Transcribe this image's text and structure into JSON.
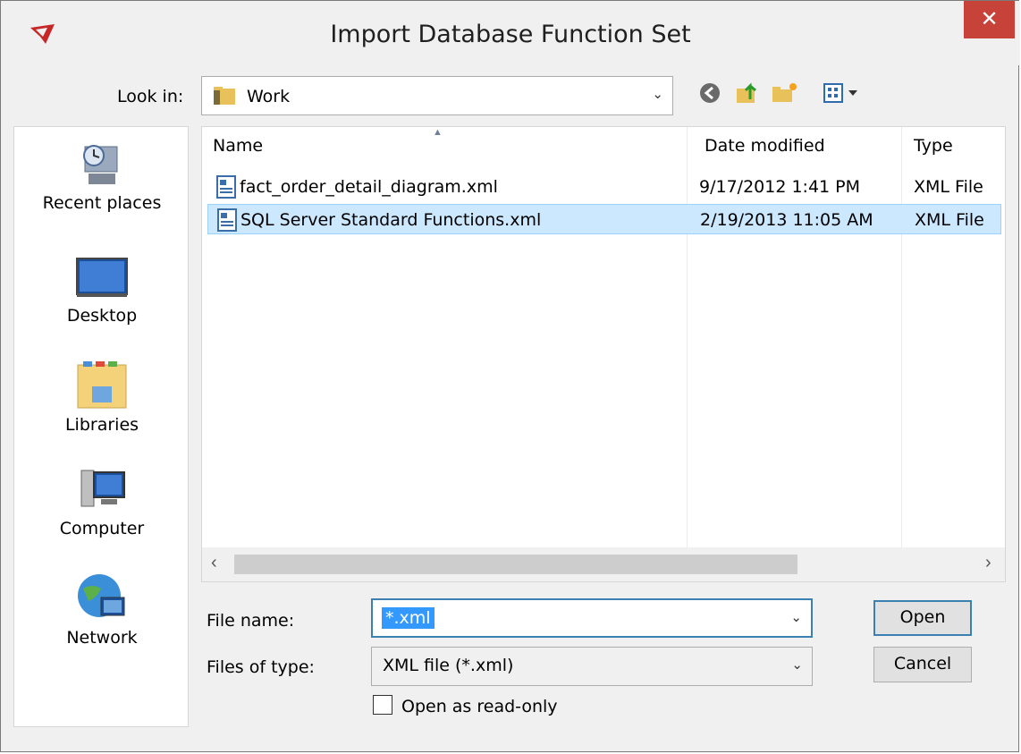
{
  "window": {
    "title": "Import Database Function Set",
    "close_glyph": "✕"
  },
  "lookin": {
    "label": "Look in:",
    "value": "Work",
    "arrow": "⌄"
  },
  "toolbar": {
    "icons": [
      "back-icon",
      "up-folder-icon",
      "new-folder-icon",
      "view-menu-icon"
    ]
  },
  "places": [
    {
      "label": "Recent places",
      "icon": "recent-places-icon"
    },
    {
      "label": "Desktop",
      "icon": "desktop-icon"
    },
    {
      "label": "Libraries",
      "icon": "libraries-icon"
    },
    {
      "label": "Computer",
      "icon": "computer-icon"
    },
    {
      "label": "Network",
      "icon": "network-icon"
    }
  ],
  "filelist": {
    "columns": [
      "Name",
      "Date modified",
      "Type"
    ],
    "rows": [
      {
        "name": "fact_order_detail_diagram.xml",
        "date": "9/17/2012 1:41 PM",
        "type": "XML File",
        "selected": false
      },
      {
        "name": "SQL Server Standard Functions.xml",
        "date": "2/19/2013 11:05 AM",
        "type": "XML File",
        "selected": true
      }
    ],
    "scroll_left": "‹",
    "scroll_right": "›"
  },
  "form": {
    "filename_label": "File name:",
    "filename_value": "*.xml",
    "filetype_label": "Files of type:",
    "filetype_value": "XML file (*.xml)",
    "readonly_label": "Open as read-only",
    "readonly_checked": false
  },
  "buttons": {
    "open": "Open",
    "cancel": "Cancel"
  },
  "colors": {
    "close_bg": "#c7433a",
    "selection_bg": "#cce8ff",
    "text_selection": "#3399ff"
  }
}
